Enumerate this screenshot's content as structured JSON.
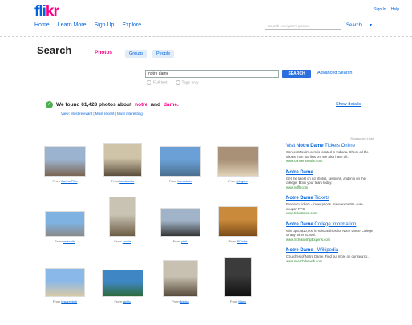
{
  "header": {
    "logo_part1": "fli",
    "logo_part2": "kr",
    "nav": [
      "Home",
      "Learn More",
      "Sign Up",
      "Explore"
    ],
    "util": [
      "...",
      "...",
      "...",
      "Sign In",
      "Help"
    ],
    "top_search_placeholder": "Search everyone's photos",
    "top_search_button": "Search",
    "top_search_caret": "▾"
  },
  "search": {
    "title": "Search",
    "tab_photos": "Photos",
    "tab_groups": "Groups",
    "tab_people": "People",
    "query": "notre dame",
    "button": "SEARCH",
    "advanced": "Advanced Search",
    "option_full_text": "Full text",
    "option_tags": "Tags only"
  },
  "results": {
    "prefix": "We found 61,428 photos about",
    "q1": "notre",
    "and": "and",
    "q2": "dame.",
    "sublinks": "View: Most relevant | Most recent | Most interesting",
    "show_details": "Show details"
  },
  "photos": [
    {
      "from": "From",
      "owner": "Carlos Pfilo",
      "colors": [
        "#9bb3cf",
        "#7a6552"
      ]
    },
    {
      "from": "From",
      "owner": "kiddstudio",
      "colors": [
        "#cfc3a8",
        "#5b4e3d"
      ]
    },
    {
      "from": "From",
      "owner": "lexrockpix",
      "colors": [
        "#6aa0d6",
        "#4b6f8e"
      ]
    },
    {
      "from": "From",
      "owner": "jdegarc",
      "colors": [
        "#a89177",
        "#e0d2b8"
      ]
    },
    {
      "from": "From",
      "owner": "onasatic",
      "colors": [
        "#7fb2e0",
        "#8a8a8a"
      ]
    },
    {
      "from": "From",
      "owner": "kudde",
      "colors": [
        "#c9c3b3",
        "#6b5c44"
      ]
    },
    {
      "from": "From",
      "owner": "pixiL",
      "colors": [
        "#a0b3c8",
        "#343434"
      ]
    },
    {
      "from": "From",
      "owner": "RDude",
      "colors": [
        "#c98a3b",
        "#7a4b18"
      ]
    },
    {
      "from": "From",
      "owner": "lesjarrettph",
      "colors": [
        "#8ab8e8",
        "#d8c9a6"
      ]
    },
    {
      "from": "From",
      "owner": "lacrito",
      "colors": [
        "#3f86c4",
        "#2e6a3a"
      ]
    },
    {
      "from": "From",
      "owner": "lkscko",
      "colors": [
        "#c8c0b0",
        "#574b3c"
      ]
    },
    {
      "from": "From",
      "owner": "Marix",
      "colors": [
        "#3b3b3b",
        "#111111"
      ]
    }
  ],
  "ads": {
    "header": "Sponsored Links",
    "items": [
      {
        "title_pre": "Visit",
        "title_bold": "Notre Dame",
        "title_post": "Tickets Online",
        "text": "ConcertsRealm.com is located in Indiana. Check all the shows from tourlists on. We also have all...",
        "url": "www.concertsrealm.com"
      },
      {
        "title_pre": "",
        "title_bold": "Notre Dame",
        "title_post": "",
        "text": "Get the latest on nd photos, sessions, and info on the college. Book your team today.",
        "url": "www.ndfh.com"
      },
      {
        "title_pre": "",
        "title_bold": "Notre Dame",
        "title_post": "Tickets",
        "text": "Premium tickets - lower prices. Save extra 5% - use coupon PFC.",
        "url": "www.ticketsnow.com"
      },
      {
        "title_pre": "",
        "title_bold": "Notre Dame",
        "title_post": "College Information",
        "text": "Win up to $10,000 in scholarships for Notre Dame College or any other school.",
        "url": "www.ScholarshipExperts.com"
      },
      {
        "title_pre": "",
        "title_bold": "Notre Dame",
        "title_post": "- Wikipedia",
        "text": "Churches of Notre Dame. Find out more on our search...",
        "url": "www.searchtheweb.com"
      }
    ]
  }
}
